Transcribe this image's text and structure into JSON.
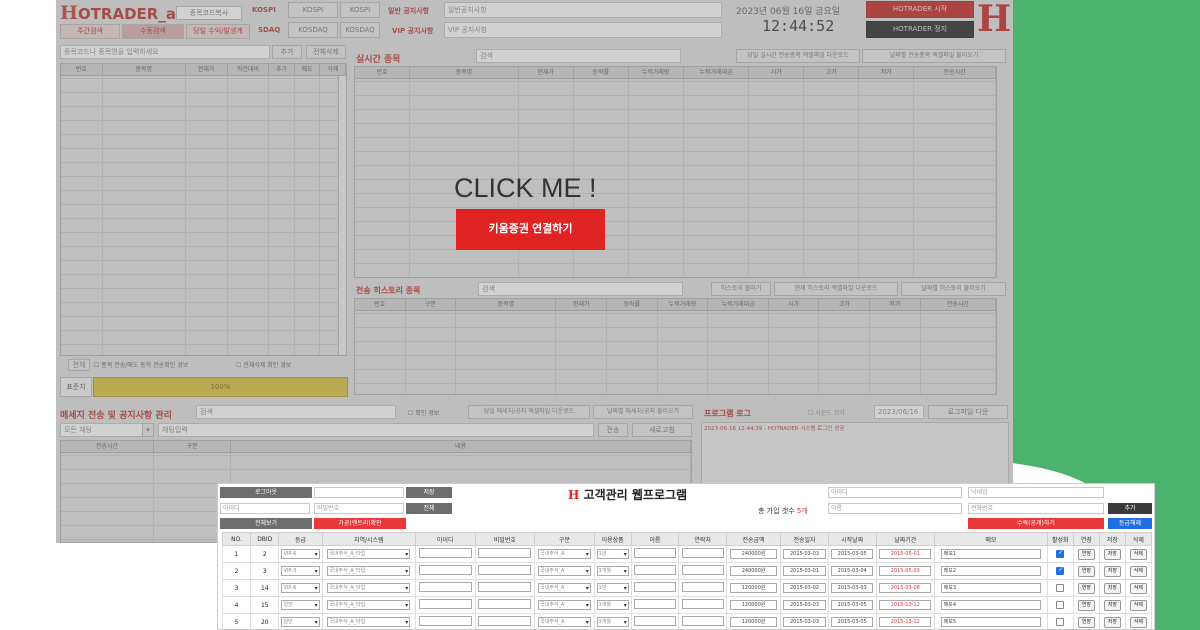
{
  "colors": {
    "accent_red": "#e02424",
    "green_bg": "#4cb36e",
    "dark_btn": "#3a3a3a",
    "blue_btn": "#1e6fe6"
  },
  "main": {
    "logo_text": "OTRADER_admin",
    "logo_h": "H",
    "top_button": "종목코드복사",
    "menu": [
      "주간검색",
      "수동검색",
      "당일 수익/발생계"
    ],
    "kospi_label": "KOSPI",
    "kosdaq_label": "SDAQ",
    "index_buttons": [
      "KOSPI",
      "KOSPI",
      "KOSDAQ",
      "KOSDAQ"
    ],
    "notice_general_label": "일반 공지사항",
    "notice_general_value": "일반공지사항",
    "notice_vip_label": "VIP 공지사항",
    "notice_vip_value": "VIP 공지사항",
    "date": "2023년 06월 16일 금요일",
    "time": "12:44:52",
    "right_buttons": [
      "HOTRADER 시작",
      "HOTRADER 정지"
    ],
    "brand_h": "H",
    "search_placeholder": "종목코드나 종목명을 입력하세요",
    "add_button": "추가",
    "delete_all_button": "전체삭제",
    "left_grid_headers": [
      "번호",
      "종목명",
      "현재가",
      "직전대비",
      "추가",
      "매도",
      "삭제"
    ],
    "realtime_title": "실시간 종목",
    "realtime_search": "검색",
    "realtime_buttons": [
      "당일 실시간 전송종목 엑셀파일 다운로드",
      "날짜별 전송종목 엑셀파일 불러오기"
    ],
    "realtime_headers": [
      "번호",
      "종목명",
      "현재가",
      "등락률",
      "누적거래량",
      "누적거래대금",
      "시가",
      "고가",
      "저가",
      "전송시간"
    ],
    "cta_text": "CLICK ME !",
    "cta_button": "키움증권 연결하기",
    "history_title": "전송 히스토리 종목",
    "history_search": "검색",
    "history_buttons": [
      "히스토리 불러기",
      "현재 히스토리 엑셀파일 다운로드",
      "날짜별 히스토리 불러오기"
    ],
    "history_headers": [
      "번호",
      "구분",
      "종목명",
      "현재가",
      "등락률",
      "누적거래량",
      "누적거래대금",
      "시가",
      "고가",
      "저가",
      "전송시간"
    ],
    "left_footer_btn": "전체",
    "left_footer_check1": "종목 전송/매도 동작 전송확인 경보",
    "left_footer_check2": "전체삭제 확인 경보",
    "progress_label": "표준치",
    "progress_value": "100%",
    "progress": 1.0,
    "message_title": "메세지 전송 및 공지사항 관리",
    "message_search": "검색",
    "message_check": "확인 경보",
    "message_buttons": [
      "당일 메세지/공지 엑셀파일 다운로드",
      "날짜별 메세지/공지 불러오기"
    ],
    "message_select": "모든 채팅",
    "message_input": "채팅입력",
    "message_send": "전송",
    "message_refresh": "새로고침",
    "message_headers": [
      "전송시간",
      "구분",
      "내용"
    ],
    "log_title": "프로그램 로그",
    "log_check": "사운드 끄기",
    "log_date": "2023/06/16",
    "log_button": "로그파일 다운",
    "log_line": "2023-06-16 12:44:39 - HOTRADER 시스템 로그인 성공"
  },
  "front": {
    "title": "고객관리 웹프로그램",
    "title_h": "H",
    "left_buttons": [
      "로그아웃",
      "전체보기",
      "전체"
    ],
    "left_inputs": [
      "아이디",
      "비밀번호",
      "이름",
      "전화번호"
    ],
    "red_button": "가공(엔트리)확인",
    "count_label": "총 가입 갯수",
    "count_value": "5",
    "count_unit": "개",
    "right_inputs": [
      "아이디",
      "닉네임",
      "전화번호"
    ],
    "right_red_button": "수락(공개)하기",
    "right_dark_button": "추가",
    "right_blue_button": "등급해제",
    "headers": [
      "NO.",
      "DBID",
      "등급",
      "지역/시스템",
      "아이디",
      "비밀번호",
      "구분",
      "이용상품",
      "이름",
      "연락처",
      "전송금액",
      "전송일자",
      "시작날짜",
      "날짜기간",
      "메모",
      "활성화",
      "연장",
      "저장",
      "삭제"
    ],
    "rows": [
      {
        "no": "1",
        "dbid": "2",
        "grade": "VIP-6",
        "sys": "국내주식_A_타입",
        "kind": "국내주식_A",
        "plan": "1년",
        "amount": "240000원",
        "d1": "2015-03-03",
        "d2": "2015-03-05",
        "d3": "2015-05-01",
        "memo": "메모1",
        "active": true
      },
      {
        "no": "2",
        "dbid": "3",
        "grade": "VIP-3",
        "sys": "국내주식_A_타입",
        "kind": "국내주식_A",
        "plan": "3개월",
        "amount": "240000원",
        "d1": "2015-03-01",
        "d2": "2015-03-04",
        "d3": "2015-05-03",
        "memo": "메모2",
        "active": true
      },
      {
        "no": "3",
        "dbid": "14",
        "grade": "VIP-6",
        "sys": "국내주식_A_타입",
        "kind": "국내주식_A",
        "plan": "1년",
        "amount": "120000원",
        "d1": "2015-03-02",
        "d2": "2015-03-03",
        "d3": "2015-03-08",
        "memo": "메모3",
        "active": false
      },
      {
        "no": "4",
        "dbid": "15",
        "grade": "일반",
        "sys": "국내주식_A_타입",
        "kind": "국내주식_A",
        "plan": "3개월",
        "amount": "120000원",
        "d1": "2015-03-03",
        "d2": "2015-03-05",
        "d3": "2015-13-12",
        "memo": "메모4",
        "active": false
      },
      {
        "no": "5",
        "dbid": "20",
        "grade": "일반",
        "sys": "국내주식_A_타입",
        "kind": "국내주식_A",
        "plan": "3개월",
        "amount": "120000원",
        "d1": "2015-03-03",
        "d2": "2015-03-05",
        "d3": "2015-13-12",
        "memo": "메모5",
        "active": false
      }
    ],
    "row_buttons": [
      "연장",
      "저장",
      "삭제"
    ]
  }
}
